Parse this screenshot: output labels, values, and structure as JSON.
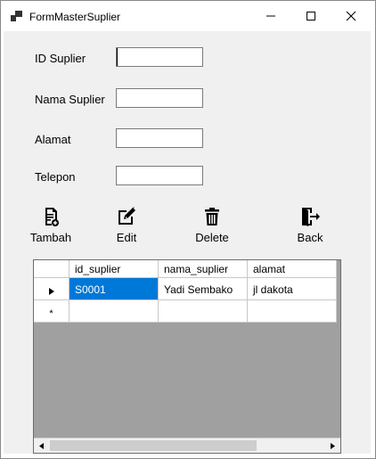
{
  "window": {
    "title": "FormMasterSuplier"
  },
  "form": {
    "fields": [
      {
        "label": "ID Suplier",
        "value": ""
      },
      {
        "label": "Nama Suplier",
        "value": ""
      },
      {
        "label": "Alamat",
        "value": ""
      },
      {
        "label": "Telepon",
        "value": ""
      }
    ]
  },
  "toolbar": {
    "tambah": "Tambah",
    "edit": "Edit",
    "delete": "Delete",
    "back": "Back"
  },
  "grid": {
    "columns": [
      "id_suplier",
      "nama_suplier",
      "alamat"
    ],
    "rows": [
      [
        "S0001",
        "Yadi Sembako",
        "jl dakota"
      ]
    ],
    "new_row_marker": "*"
  },
  "colors": {
    "selection": "#0078d7",
    "client_bg": "#f0f0f0",
    "grid_bg": "#a0a0a0"
  }
}
